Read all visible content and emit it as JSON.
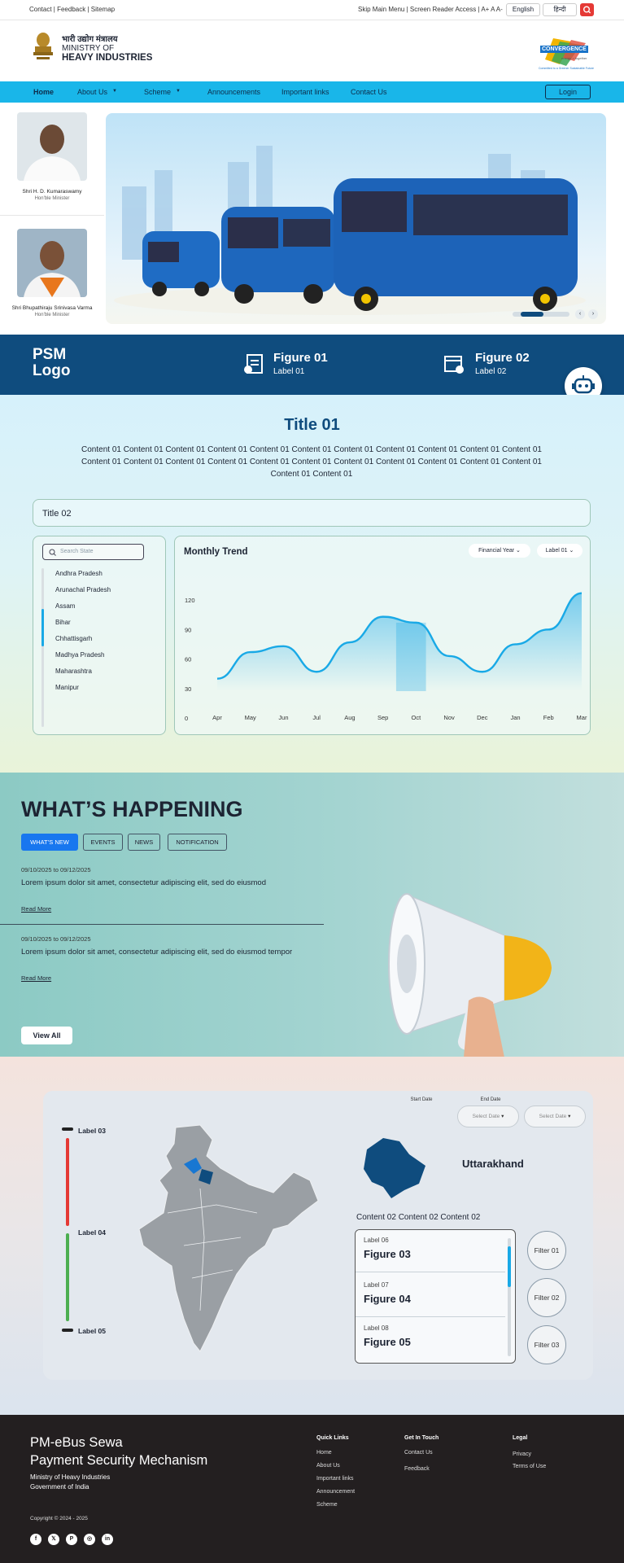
{
  "utility": {
    "left": "Contact | Feedback | Sitemap",
    "right": "Skip Main Menu | Screen Reader Access | A+ A A-",
    "lang_en": "English",
    "lang_hi": "हिन्दी"
  },
  "brand": {
    "hindi": "भारी उद्योग मंत्रालय",
    "line1": "MINISTRY OF",
    "line2": "HEAVY INDUSTRIES",
    "partner_logo": "CONVERGENCE",
    "partner_sub": "energy > together",
    "partner_tag": "Committed to a Greener Sustainable Future"
  },
  "nav": {
    "items": [
      "Home",
      "About Us",
      "Scheme",
      "Announcements",
      "Important links",
      "Contact Us"
    ],
    "login": "Login"
  },
  "ministers": [
    {
      "name": "Shri H. D. Kumaraswamy",
      "role": "Hon'ble Minister"
    },
    {
      "name": "Shri Bhupathiraju Srinivasa Varma",
      "role": "Hon'ble Minister"
    }
  ],
  "band": {
    "logo_line1": "PSM",
    "logo_line2": "Logo",
    "figures": [
      {
        "value": "Figure 01",
        "label": "Label 01"
      },
      {
        "value": "Figure 02",
        "label": "Label 02"
      }
    ]
  },
  "intro": {
    "title": "Title 01",
    "content": "Content 01 Content 01 Content 01 Content 01 Content 01 Content 01 Content 01 Content 01 Content 01 Content 01 Content 01 Content 01 Content 01 Content 01 Content 01 Content 01 Content 01 Content 01 Content 01 Content 01 Content 01 Content 01 Content 01 Content 01",
    "title2": "Title 02"
  },
  "states": {
    "placeholder": "Search State",
    "items": [
      "Andhra Pradesh",
      "Arunachal Pradesh",
      "Assam",
      "Bihar",
      "Chhattisgarh",
      "Madhya Pradesh",
      "Maharashtra",
      "Manipur"
    ]
  },
  "chart_data": {
    "type": "area",
    "title": "Monthly Trend",
    "filters": [
      "Financial Year",
      "Label 01"
    ],
    "categories": [
      "Apr",
      "May",
      "Jun",
      "Jul",
      "Aug",
      "Sep",
      "Oct",
      "Nov",
      "Dec",
      "Jan",
      "Feb",
      "Mar"
    ],
    "series": [
      {
        "values": [
          40,
          67,
          73,
          47,
          77,
          103,
          97,
          63,
          47,
          75,
          90,
          127
        ]
      }
    ],
    "yticks": [
      "0",
      "30",
      "60",
      "90",
      "120"
    ],
    "ylim": [
      0,
      135
    ],
    "highlight": "Oct",
    "accent": "#19a9e6"
  },
  "happening": {
    "title": "WHAT’S HAPPENING",
    "tabs": [
      "WHAT’S NEW",
      "EVENTS",
      "NEWS",
      "NOTIFICATION"
    ],
    "items": [
      {
        "date": "09/10/2025 to 09/12/2025",
        "text": "Lorem ipsum dolor sit amet, consectetur adipiscing elit, sed do eiusmod",
        "link": "Read More"
      },
      {
        "date": "09/10/2025 to 09/12/2025",
        "text": "Lorem ipsum dolor sit amet, consectetur adipiscing elit, sed do eiusmod tempor",
        "link": "Read More"
      }
    ],
    "view_all": "View All"
  },
  "mapsection": {
    "start_label": "Start Date",
    "start_ph": "Select Date",
    "end_label": "End Date",
    "end_ph": "Select Date",
    "legend": [
      "Label 03",
      "Label 04",
      "Label 05"
    ],
    "legend_colors": [
      "#e53935",
      "#4caf50",
      "#222222"
    ],
    "state": "Uttarakhand",
    "content": "Content 02 Content 02 Content 02",
    "entries": [
      {
        "label": "Label 06",
        "value": "Figure 03"
      },
      {
        "label": "Label 07",
        "value": "Figure 04"
      },
      {
        "label": "Label 08",
        "value": "Figure 05"
      }
    ],
    "filters": [
      "Filter 01",
      "Filter 02",
      "Filter 03"
    ]
  },
  "footer": {
    "title1": "PM-eBus Sewa",
    "title2": "Payment Security Mechanism",
    "org1": "Ministry of Heavy Industries",
    "org2": "Government of India",
    "copyright": "Copyright © 2024 - 2025",
    "col1": {
      "head": "Quick Links",
      "items": [
        "Home",
        "About Us",
        "Important links",
        "Announcement",
        "Scheme"
      ]
    },
    "col2": {
      "head": "Get In Touch",
      "items": [
        "Contact Us",
        "Feedback"
      ]
    },
    "col3": {
      "head": "Legal",
      "items": [
        "Privacy",
        "Terms of Use"
      ]
    },
    "social": [
      "facebook-icon",
      "x-icon",
      "pinterest-icon",
      "instagram-icon",
      "linkedin-icon"
    ]
  }
}
